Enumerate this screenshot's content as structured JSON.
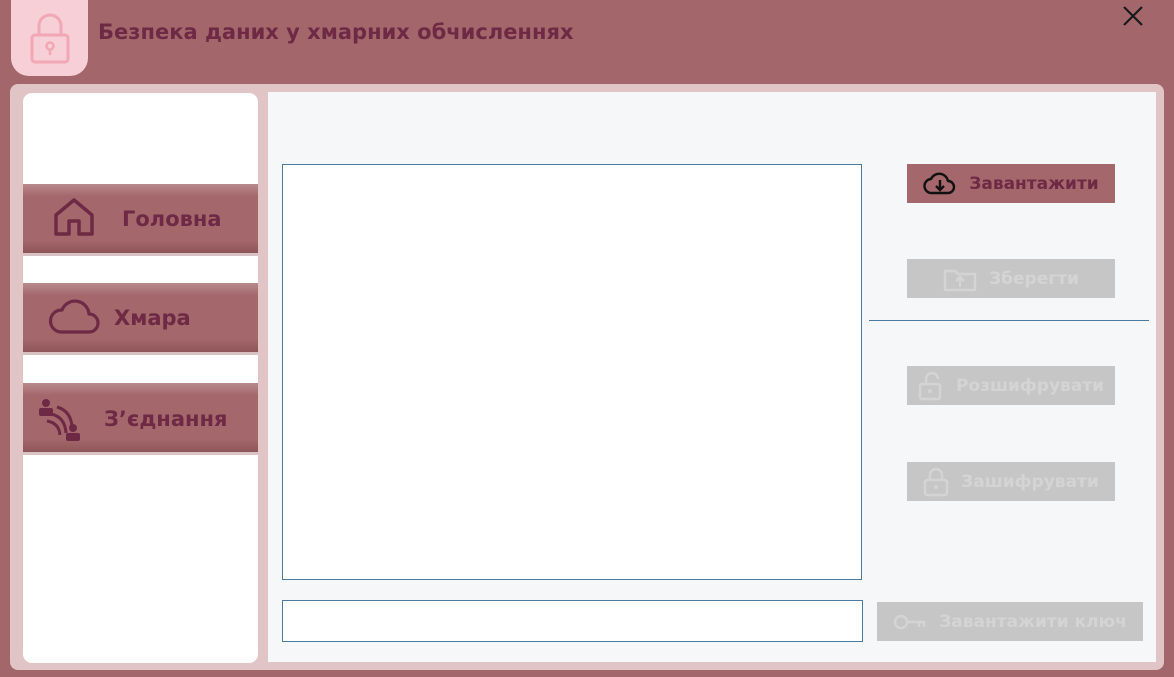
{
  "window": {
    "title": "Безпека даних у хмарних обчисленнях",
    "logo_icon": "lock-icon",
    "close_icon": "close-icon"
  },
  "sidebar": {
    "items": [
      {
        "label": "Головна",
        "icon": "home-icon"
      },
      {
        "label": "Хмара",
        "icon": "cloud-icon"
      },
      {
        "label": "З’єднання",
        "icon": "connection-icon"
      }
    ]
  },
  "editor": {
    "text_value": "",
    "key_value": ""
  },
  "actions": {
    "upload_label": "Завантажити",
    "save_label": "Зберегти",
    "decrypt_label": "Розшифрувати",
    "encrypt_label": "Зашифрувати",
    "load_key_label": "Завантажити ключ"
  },
  "colors": {
    "background": "#a3676b",
    "accent": "#6e2a45",
    "button_enabled": "#a4676b",
    "button_disabled": "#c6c6c6",
    "input_border": "#4a7ba3"
  }
}
